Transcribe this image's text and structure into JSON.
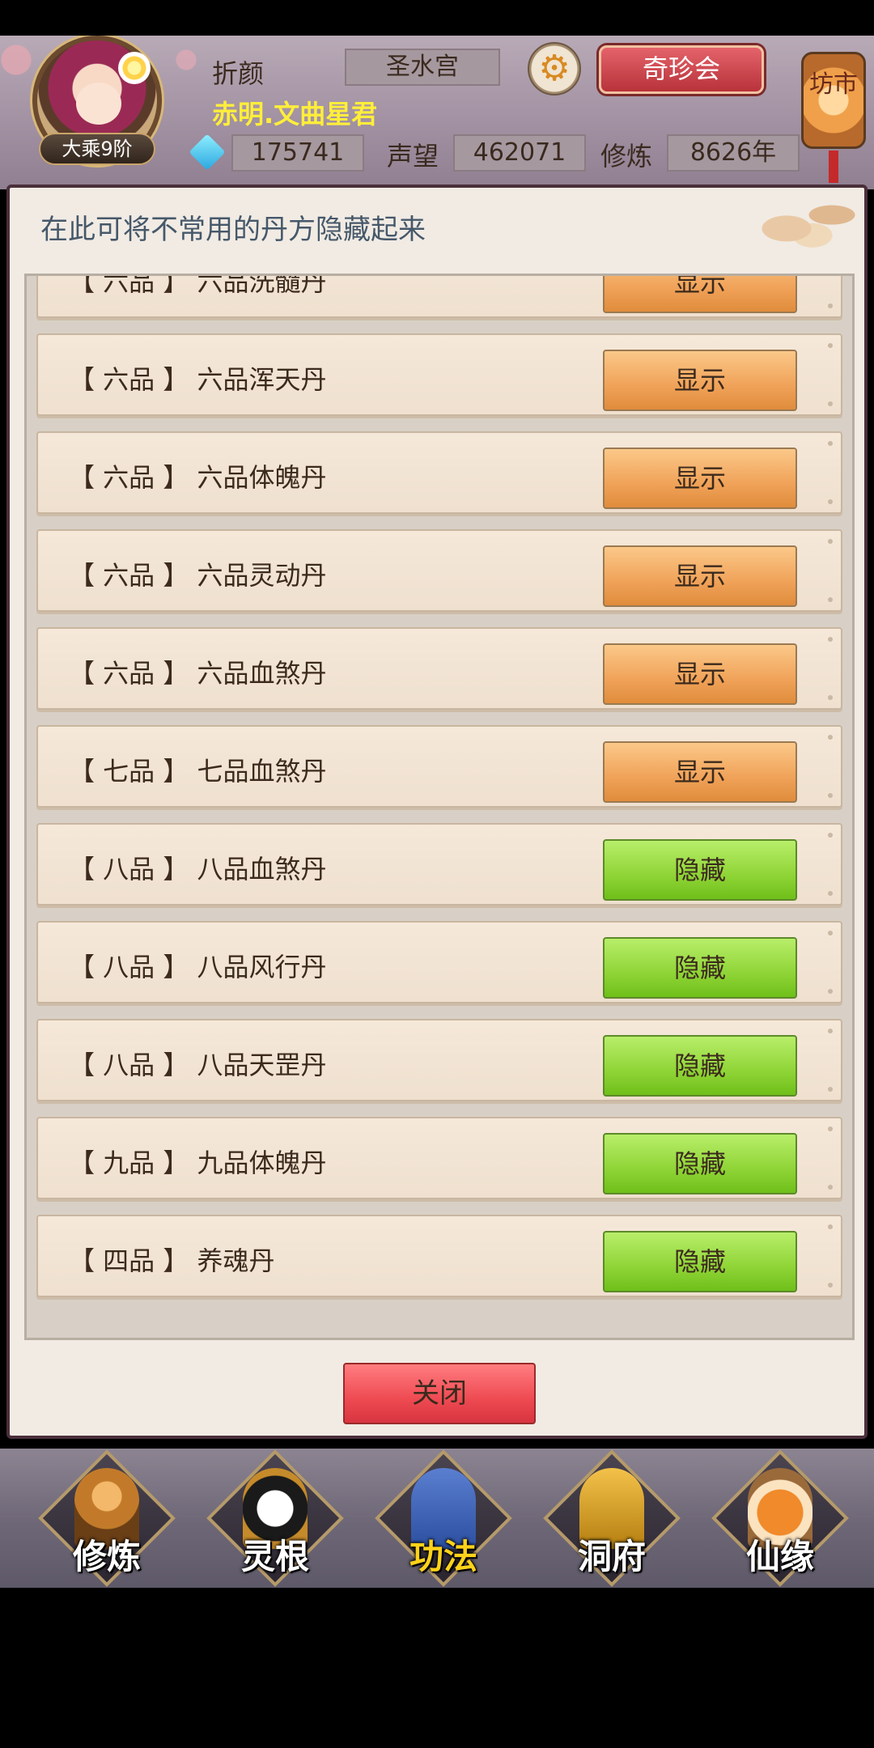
{
  "header": {
    "player_name": "折颜",
    "sect": "圣水宫",
    "title": "赤明.文曲星君",
    "rank": "大乘9阶",
    "spirit_stones": "175741",
    "reputation_label": "声望",
    "reputation": "462071",
    "cultivation_label": "修炼",
    "cultivation": "8626年",
    "treasure_button": "奇珍会",
    "market_lantern": "坊市"
  },
  "dialog": {
    "hint": "在此可将不常用的丹方隐藏起来",
    "close_button": "关闭",
    "rows": [
      {
        "label": "【 六品 】 六品洗髓丹",
        "action": "显示",
        "state": "show"
      },
      {
        "label": "【 六品 】 六品浑天丹",
        "action": "显示",
        "state": "show"
      },
      {
        "label": "【 六品 】 六品体魄丹",
        "action": "显示",
        "state": "show"
      },
      {
        "label": "【 六品 】 六品灵动丹",
        "action": "显示",
        "state": "show"
      },
      {
        "label": "【 六品 】 六品血煞丹",
        "action": "显示",
        "state": "show"
      },
      {
        "label": "【 七品 】 七品血煞丹",
        "action": "显示",
        "state": "show"
      },
      {
        "label": "【 八品 】 八品血煞丹",
        "action": "隐藏",
        "state": "hide"
      },
      {
        "label": "【 八品 】 八品风行丹",
        "action": "隐藏",
        "state": "hide"
      },
      {
        "label": "【 八品 】 八品天罡丹",
        "action": "隐藏",
        "state": "hide"
      },
      {
        "label": "【 九品 】 九品体魄丹",
        "action": "隐藏",
        "state": "hide"
      },
      {
        "label": "【 四品 】 养魂丹",
        "action": "隐藏",
        "state": "hide"
      }
    ]
  },
  "bottom_nav": {
    "items": [
      {
        "label": "修炼",
        "icon": "hooded-monk-icon",
        "active": false
      },
      {
        "label": "灵根",
        "icon": "sword-yinyang-icon",
        "active": false
      },
      {
        "label": "功法",
        "icon": "book-icon",
        "active": true
      },
      {
        "label": "洞府",
        "icon": "pagoda-icon",
        "active": false
      },
      {
        "label": "仙缘",
        "icon": "gourd-icon",
        "active": false
      }
    ]
  },
  "colors": {
    "show_button": "#f0a258",
    "hide_button": "#8fd436",
    "close_button": "#ee4a52",
    "title_yellow": "#ffee3a",
    "active_nav": "#ffd21a"
  }
}
